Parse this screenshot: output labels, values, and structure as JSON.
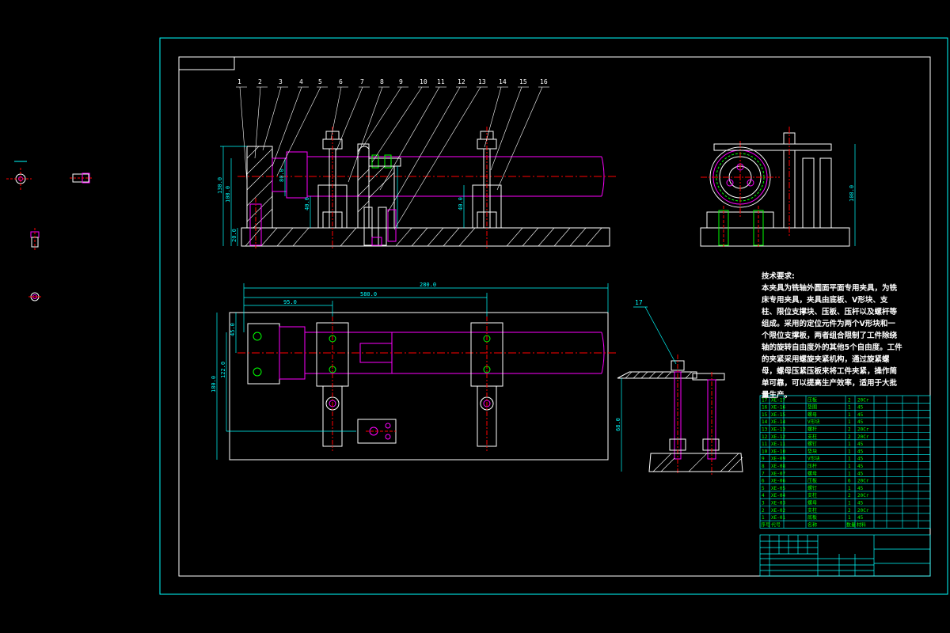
{
  "colors": {
    "background": "#000000",
    "frame": "#00ffff",
    "outline": "#ffffff",
    "part": "#ff00ff",
    "bolt": "#00ff00",
    "center": "#ff0000",
    "dimension": "#00ffff",
    "table": "#00ffff",
    "title_text": "#00ff00"
  },
  "front_view": {
    "balloons": [
      "1",
      "2",
      "3",
      "4",
      "5",
      "6",
      "7",
      "8",
      "9",
      "10",
      "11",
      "12",
      "13",
      "14",
      "15",
      "16"
    ],
    "dimensions": {
      "total_height": "130.0",
      "height_2": "108.0",
      "height_3": "80.0",
      "base": "20.0",
      "small": "40.0",
      "mid": "40.0"
    }
  },
  "side_view": {
    "dimensions": {
      "height": "108.0"
    }
  },
  "top_view": {
    "dimensions": {
      "overall": "280.0",
      "span_1": "580.0",
      "span_2": "95.0",
      "vertical_1": "45.0",
      "vertical_2": "122.0",
      "vertical_3": "180.0"
    }
  },
  "section_view": {
    "balloon": "17",
    "dimensions": {
      "height": "68.0"
    }
  },
  "tech_requirements": {
    "title": "技术要求:",
    "body": "本夹具为铣轴外圆面平面专用夹具，为铣床专用夹具，夹具由底板、V形块、支柱、限位支撑块、压板、压杆以及螺杆等组成。采用的定位元件为两个V形块和一个限位支撑板，两者组合限制了工件除绕轴的旋转自由度外的其他5个自由度。工件的夹紧采用螺旋夹紧机构，通过旋紧螺母，螺母压紧压板来将工件夹紧，操作简单可靠，可以提高生产效率，适用于大批量生产。"
  },
  "bom_rows": [
    {
      "no": "17",
      "code": "XE-17",
      "name": "压板",
      "qty": "2",
      "mat": "20Cr"
    },
    {
      "no": "16",
      "code": "XE-16",
      "name": "垫圈",
      "qty": "1",
      "mat": "45"
    },
    {
      "no": "15",
      "code": "XE-15",
      "name": "螺母",
      "qty": "1",
      "mat": "45"
    },
    {
      "no": "14",
      "code": "XE-14",
      "name": "V形块",
      "qty": "1",
      "mat": "45"
    },
    {
      "no": "13",
      "code": "XE-13",
      "name": "螺杆",
      "qty": "2",
      "mat": "20Cr"
    },
    {
      "no": "12",
      "code": "XE-12",
      "name": "支柱",
      "qty": "2",
      "mat": "20Cr"
    },
    {
      "no": "11",
      "code": "XE-11",
      "name": "螺钉",
      "qty": "1",
      "mat": "45"
    },
    {
      "no": "10",
      "code": "XE-10",
      "name": "垫块",
      "qty": "1",
      "mat": "45"
    },
    {
      "no": "9",
      "code": "XE-09",
      "name": "V形块",
      "qty": "1",
      "mat": "45"
    },
    {
      "no": "8",
      "code": "XE-08",
      "name": "压杆",
      "qty": "1",
      "mat": "45"
    },
    {
      "no": "7",
      "code": "XE-07",
      "name": "螺母",
      "qty": "1",
      "mat": "45"
    },
    {
      "no": "6",
      "code": "XE-06",
      "name": "压板",
      "qty": "6",
      "mat": "20Cr"
    },
    {
      "no": "5",
      "code": "XE-05",
      "name": "螺钉",
      "qty": "1",
      "mat": "45"
    },
    {
      "no": "4",
      "code": "XE-04",
      "name": "支柱",
      "qty": "2",
      "mat": "20Cr"
    },
    {
      "no": "3",
      "code": "XE-03",
      "name": "螺母",
      "qty": "1",
      "mat": "45"
    },
    {
      "no": "2",
      "code": "XE-02",
      "name": "支柱",
      "qty": "2",
      "mat": "20Cr"
    },
    {
      "no": "1",
      "code": "XE-01",
      "name": "底板",
      "qty": "1",
      "mat": "45"
    }
  ],
  "bom_header": {
    "no": "序号",
    "code": "代号",
    "name": "名称",
    "qty": "数量",
    "mat": "材料"
  }
}
